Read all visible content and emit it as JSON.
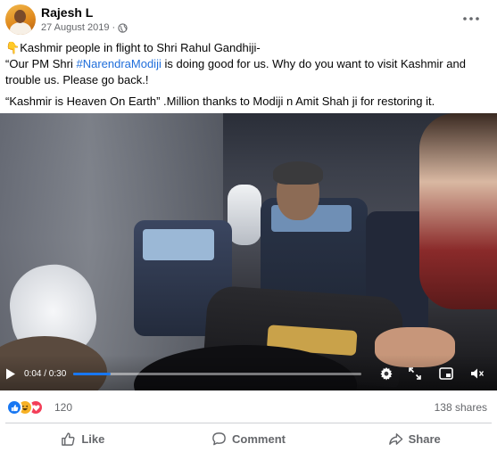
{
  "post": {
    "author": "Rajesh L",
    "date": "27 August 2019",
    "separator": "·",
    "caption": {
      "line1_emoji": "👇",
      "line1_text": "Kashmir people in flight to Shri Rahul Gandhiji-",
      "line2_prefix": "“Our PM Shri ",
      "line2_hashtag": "#NarendraModiji",
      "line2_suffix": " is doing good for us. Why do you want to visit Kashmir and trouble us. Please go back.!",
      "line3": "“Kashmir is Heaven On Earth” .Million thanks to Modiji n Amit Shah ji for restoring it."
    }
  },
  "video": {
    "current_time": "0:04",
    "duration": "0:30",
    "time_label": "0:04 / 0:30",
    "progress_fraction": 0.13
  },
  "engagement": {
    "reaction_count": "120",
    "shares": "138 shares",
    "reaction_types": [
      "like-icon",
      "haha-icon",
      "love-icon"
    ]
  },
  "actions": {
    "like": "Like",
    "comment": "Comment",
    "share": "Share"
  },
  "colors": {
    "accent": "#1877f2",
    "hashtag": "#216fdb",
    "secondary_text": "#65676b",
    "love": "#f33e58",
    "haha": "#f7b125"
  }
}
